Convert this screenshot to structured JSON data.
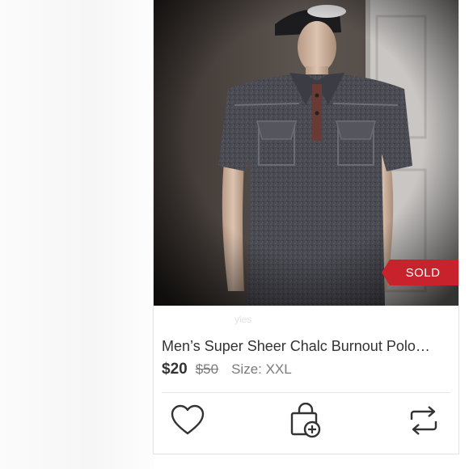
{
  "listing": {
    "title": "Men’s Super Sheer Chalc Burnout Polo…",
    "price": "$20",
    "original_price": "$50",
    "size_text": "Size: XXL",
    "status_badge": "SOLD",
    "ghost_text": "yles"
  },
  "actions": {
    "like_icon": "heart-icon",
    "bundle_icon": "shopping-bag-plus-icon",
    "share_icon": "share-repost-icon"
  },
  "colors": {
    "sold_badge": "#c8232c",
    "title_text": "#333333",
    "muted_text": "#7a7a7a"
  }
}
